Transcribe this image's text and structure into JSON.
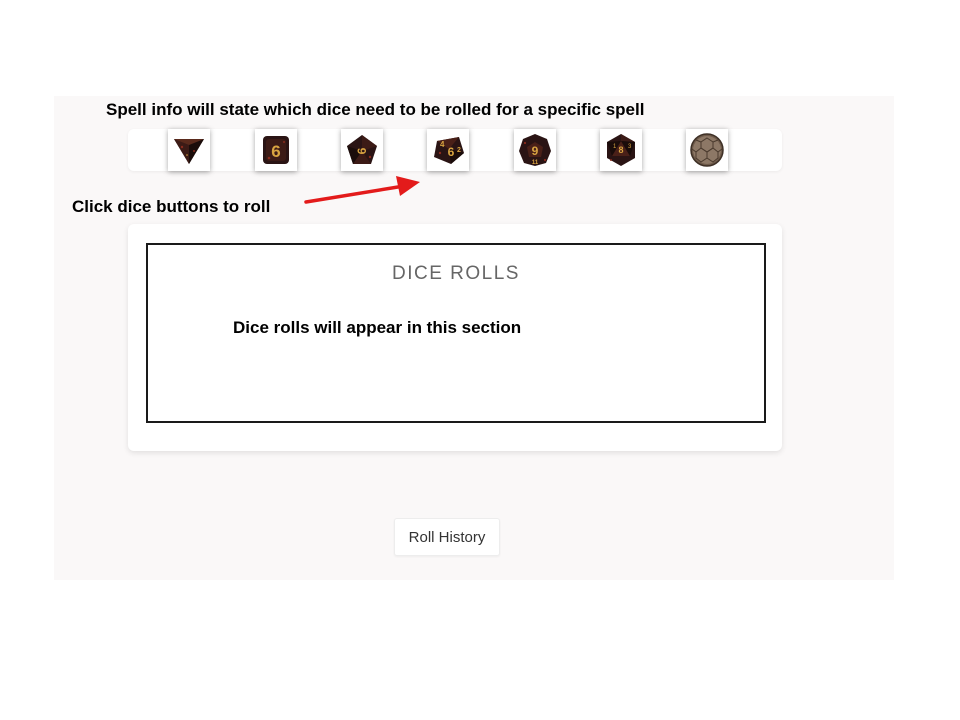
{
  "annotations": {
    "spell_info": "Spell info will state which dice need to be rolled for a specific spell",
    "click_dice": "Click dice buttons to roll"
  },
  "dice_buttons": [
    {
      "icon": "d4-icon",
      "digit": ""
    },
    {
      "icon": "d6-icon",
      "digit": "6"
    },
    {
      "icon": "d8-icon",
      "digit": "6"
    },
    {
      "icon": "d10-icon",
      "digit": "6"
    },
    {
      "icon": "d12-icon",
      "digit": "9"
    },
    {
      "icon": "d20-icon",
      "digit": "8"
    },
    {
      "icon": "d100-icon",
      "digit": ""
    }
  ],
  "rolls_panel": {
    "title": "DICE ROLLS",
    "placeholder": "Dice rolls will appear in this section"
  },
  "roll_history_label": "Roll History",
  "colors": {
    "arrow": "#e31b1b",
    "die_body": "#2a1414",
    "die_accent": "#8a2a1c",
    "die_numeral": "#d9a441",
    "panel_bg": "#faf8f8"
  }
}
